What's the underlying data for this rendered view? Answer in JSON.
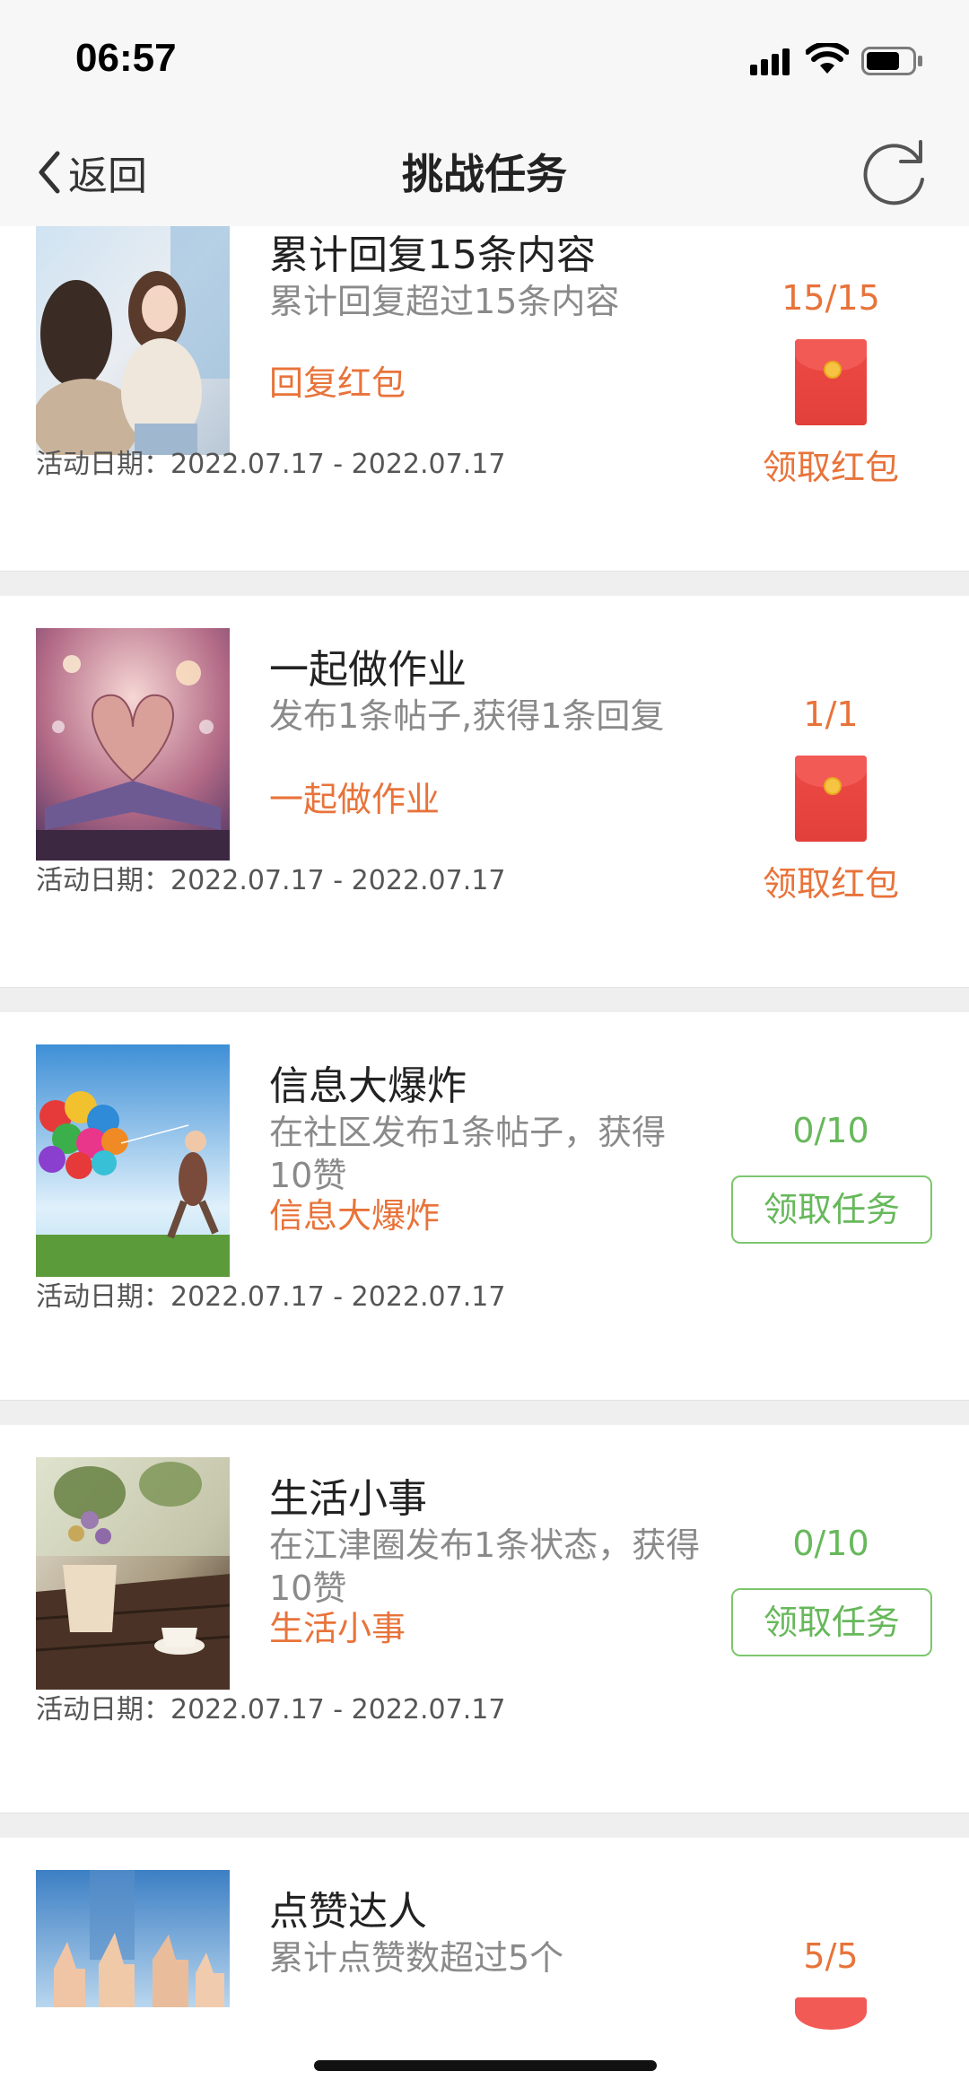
{
  "status_bar": {
    "time": "06:57",
    "icons": [
      "signal-icon",
      "wifi-icon",
      "battery-icon"
    ]
  },
  "nav": {
    "back_label": "返回",
    "title": "挑战任务",
    "icons": [
      "chevron-left-icon",
      "refresh-icon"
    ]
  },
  "colors": {
    "accent_orange": "#e8733a",
    "accent_green": "#67b85b",
    "red_packet": "#e2403b"
  },
  "tasks": [
    {
      "title": "累计回复15条内容",
      "desc": "累计回复超过15条内容",
      "tag": "回复红包",
      "date": "活动日期：2022.07.17 - 2022.07.17",
      "progress": "15/15",
      "action": "领取红包",
      "image": "two-girls-photo"
    },
    {
      "title": "一起做作业",
      "desc": "发布1条帖子,获得1条回复",
      "tag": "一起做作业",
      "date": "活动日期：2022.07.17 - 2022.07.17",
      "progress": "1/1",
      "action": "领取红包",
      "image": "book-heart-photo"
    },
    {
      "title": "信息大爆炸",
      "desc": "在社区发布1条帖子，获得10赞",
      "tag": "信息大爆炸",
      "date": "活动日期：2022.07.17 - 2022.07.17",
      "progress": "0/10",
      "action": "领取任务",
      "image": "balloons-photo"
    },
    {
      "title": "生活小事",
      "desc": "在江津圈发布1条状态，获得10赞",
      "tag": "生活小事",
      "date": "活动日期：2022.07.17 - 2022.07.17",
      "progress": "0/10",
      "action": "领取任务",
      "image": "cafe-table-photo"
    },
    {
      "title": "点赞达人",
      "desc": "累计点赞数超过5个",
      "progress": "5/5",
      "image": "thumbs-up-photo"
    }
  ]
}
